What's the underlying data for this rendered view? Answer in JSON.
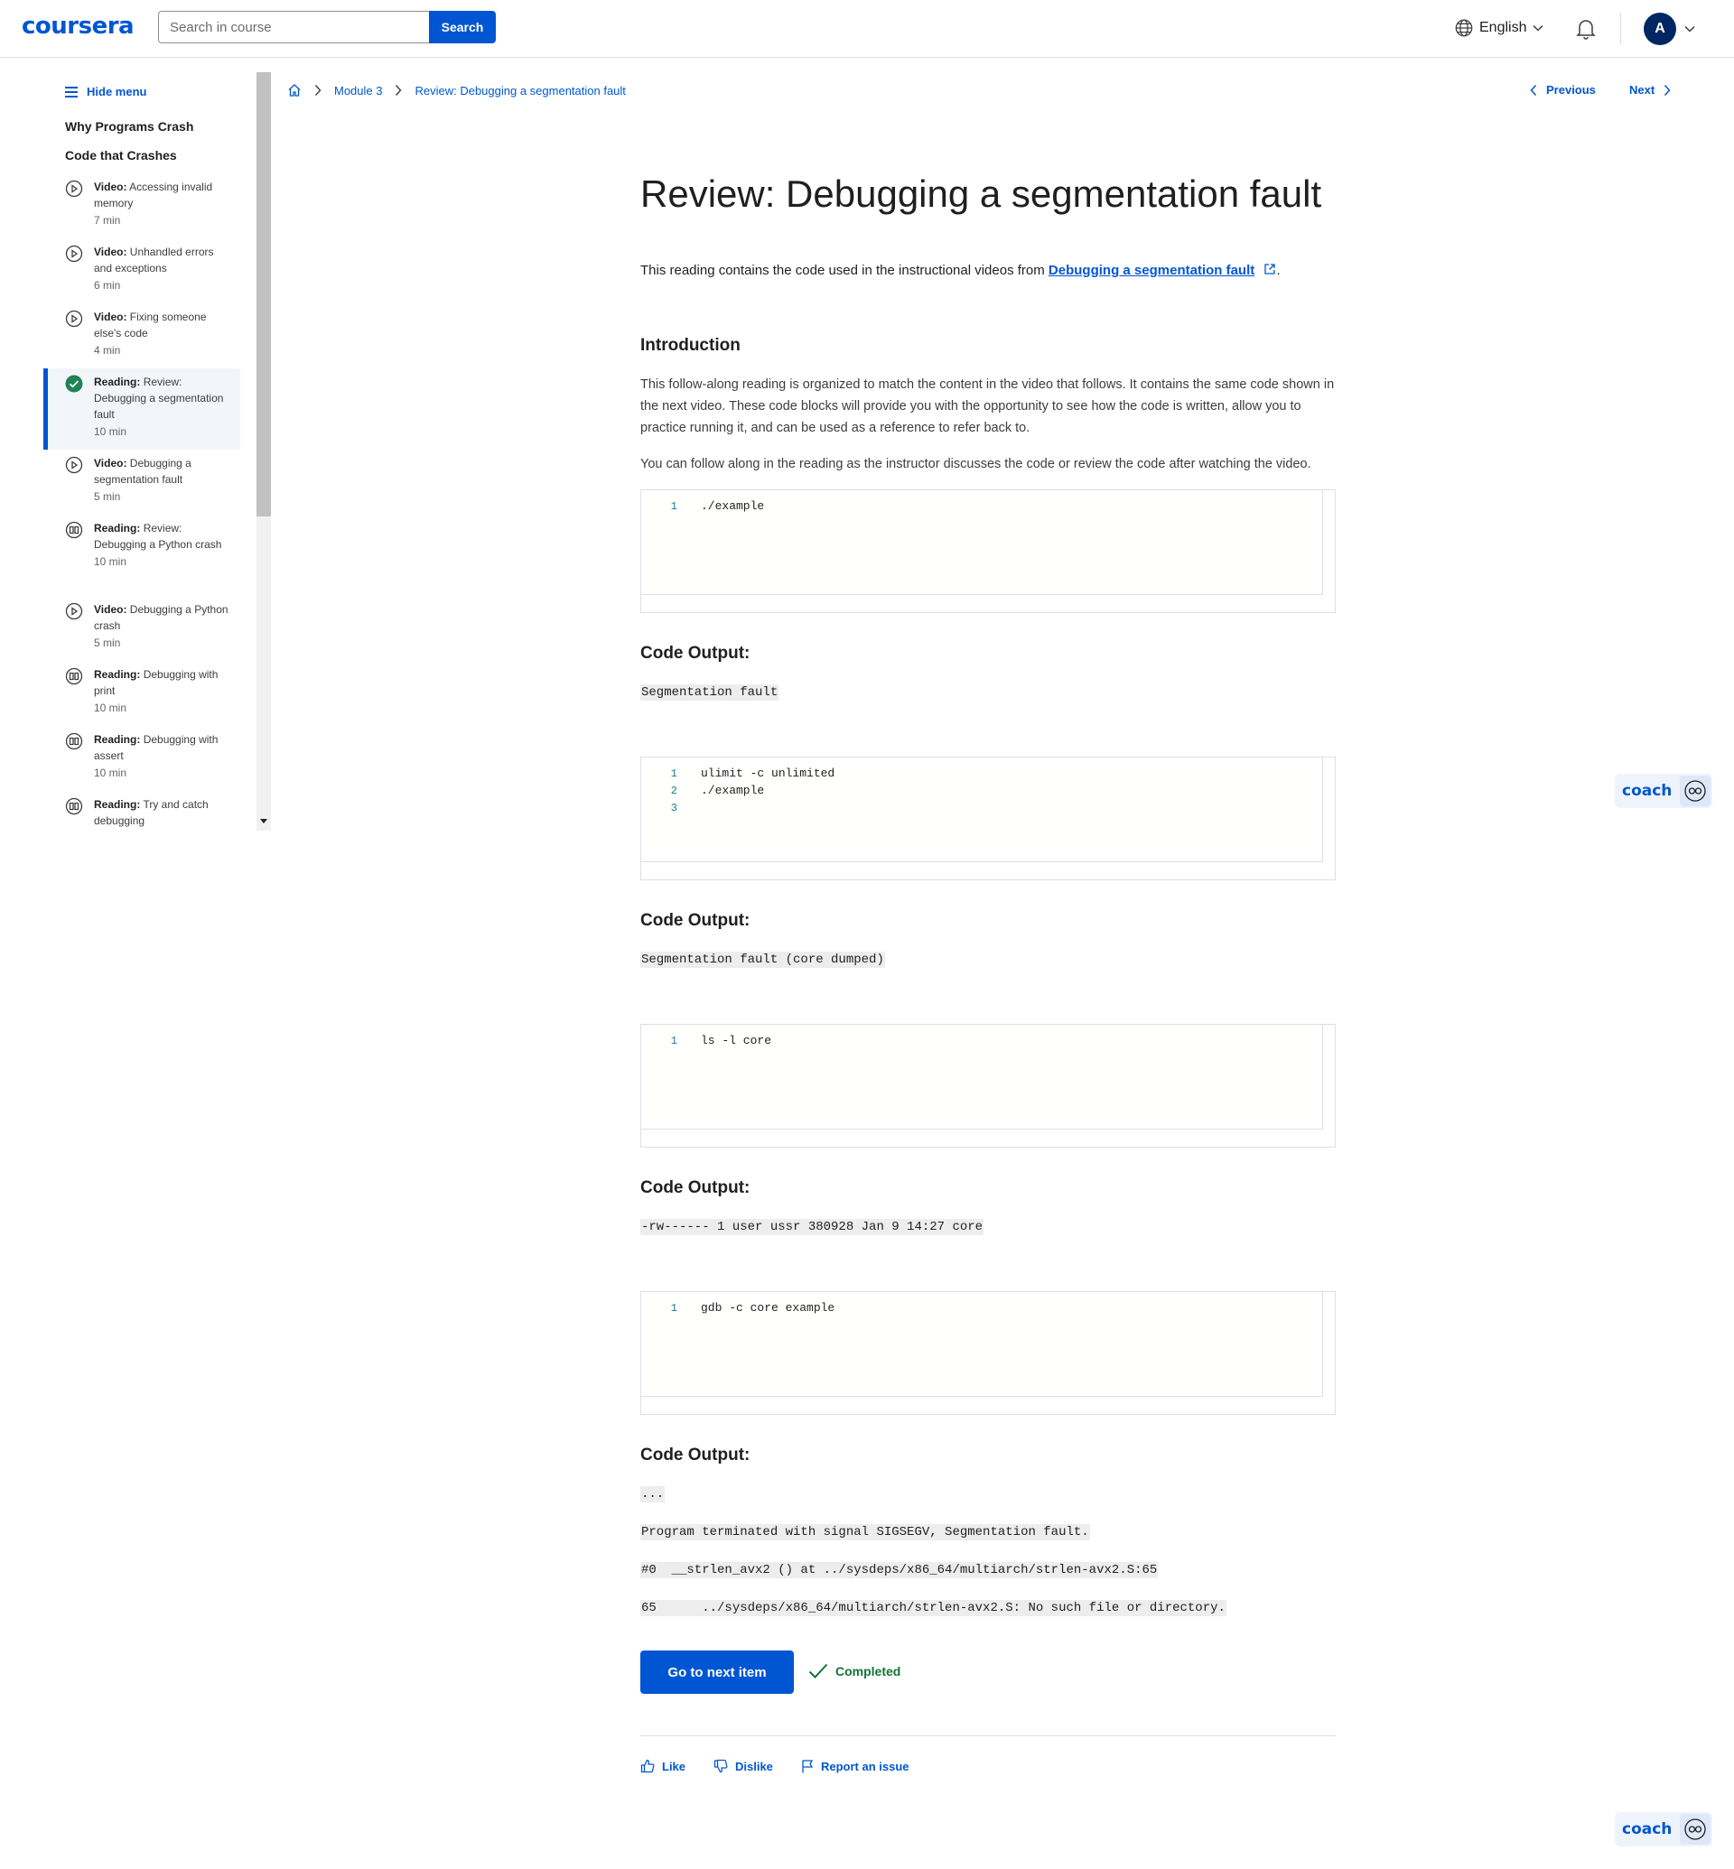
{
  "header": {
    "logo": "coursera",
    "search_placeholder": "Search in course",
    "search_button": "Search",
    "language": "English",
    "avatar_initial": "A"
  },
  "sidebar": {
    "hide_menu": "Hide menu",
    "course_title": "Why Programs Crash",
    "section_title": "Code that Crashes",
    "items": [
      {
        "type": "Video:",
        "title": "Accessing invalid memory",
        "duration": "7 min",
        "icon": "play-circle-icon"
      },
      {
        "type": "Video:",
        "title": "Unhandled errors and exceptions",
        "duration": "6 min",
        "icon": "play-circle-icon"
      },
      {
        "type": "Video:",
        "title": "Fixing someone else's code",
        "duration": "4 min",
        "icon": "play-circle-icon"
      },
      {
        "type": "Reading:",
        "title": "Review: Debugging a segmentation fault",
        "duration": "10 min",
        "icon": "check-circle-icon",
        "active": true
      },
      {
        "type": "Video:",
        "title": "Debugging a segmentation fault",
        "duration": "5 min",
        "icon": "play-circle-icon"
      },
      {
        "type": "Reading:",
        "title": "Review: Debugging a Python crash",
        "duration": "10 min",
        "icon": "book-icon"
      },
      {
        "type": "Video:",
        "title": "Debugging a Python crash",
        "duration": "5 min",
        "icon": "play-circle-icon"
      },
      {
        "type": "Reading:",
        "title": "Debugging with print",
        "duration": "10 min",
        "icon": "book-icon"
      },
      {
        "type": "Reading:",
        "title": "Debugging with assert",
        "duration": "10 min",
        "icon": "book-icon"
      },
      {
        "type": "Reading:",
        "title": "Try and catch debugging",
        "duration": "",
        "icon": "book-icon"
      }
    ]
  },
  "breadcrumb": {
    "module": "Module 3",
    "current": "Review: Debugging a segmentation fault"
  },
  "nav": {
    "previous": "Previous",
    "next": "Next"
  },
  "content": {
    "title": "Review: Debugging a segmentation fault",
    "intro_prefix": "This reading contains the code used in the instructional videos from ",
    "intro_link": "Debugging a segmentation fault",
    "intro_suffix": ".",
    "introduction_heading": "Introduction",
    "para1": "This follow-along reading is organized to match the content in the video that follows. It contains the same code shown in the next video. These code blocks will provide you with the opportunity to see how the code is written, allow you to practice running it, and can be used as a reference to refer back to.",
    "para2": "You can follow along in the reading as the instructor discusses the code or review the code after watching the video.",
    "code_blocks": [
      {
        "lines": [
          "./example"
        ]
      },
      {
        "lines": [
          "ulimit -c unlimited",
          "./example",
          ""
        ]
      },
      {
        "lines": [
          "ls -l core"
        ]
      },
      {
        "lines": [
          "gdb -c core example"
        ]
      }
    ],
    "output_heading": "Code Output:",
    "outputs": [
      [
        "Segmentation fault"
      ],
      [
        "Segmentation fault (core dumped)"
      ],
      [
        "-rw------ 1 user ussr 380928 Jan 9 14:27 core"
      ],
      [
        "...",
        "Program terminated with signal SIGSEGV, Segmentation fault.",
        "#0  __strlen_avx2 () at ../sysdeps/x86_64/multiarch/strlen-avx2.S:65",
        "65      ../sysdeps/x86_64/multiarch/strlen-avx2.S: No such file or directory."
      ]
    ],
    "next_button": "Go to next item",
    "completed": "Completed",
    "like": "Like",
    "dislike": "Dislike",
    "report": "Report an issue"
  },
  "coach": {
    "label": "coach"
  },
  "colors": {
    "brand": "#0056d2",
    "success": "#137333",
    "avatar": "#002761"
  }
}
